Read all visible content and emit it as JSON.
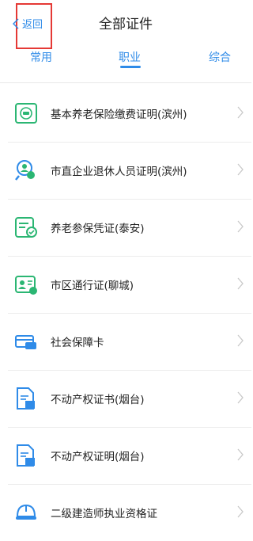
{
  "header": {
    "back_label": "返回",
    "title": "全部证件"
  },
  "tabs": [
    {
      "label": "常用",
      "active": false
    },
    {
      "label": "职业",
      "active": true
    },
    {
      "label": "综合",
      "active": false
    }
  ],
  "items": [
    {
      "label": "基本养老保险缴费证明(滨州)",
      "icon": "insurance-certificate-icon"
    },
    {
      "label": "市直企业退休人员证明(滨州)",
      "icon": "retiree-search-icon"
    },
    {
      "label": "养老参保凭证(泰安)",
      "icon": "pension-voucher-icon"
    },
    {
      "label": "市区通行证(聊城)",
      "icon": "id-card-pass-icon"
    },
    {
      "label": "社会保障卡",
      "icon": "social-security-card-icon"
    },
    {
      "label": "不动产权证书(烟台)",
      "icon": "property-certificate-book-icon"
    },
    {
      "label": "不动产权证明(烟台)",
      "icon": "property-proof-document-icon"
    },
    {
      "label": "二级建造师执业资格证",
      "icon": "construction-helmet-icon"
    }
  ],
  "colors": {
    "accent": "#2f8be8",
    "icon_green": "#2bb673",
    "highlight_box": "#e53935"
  }
}
